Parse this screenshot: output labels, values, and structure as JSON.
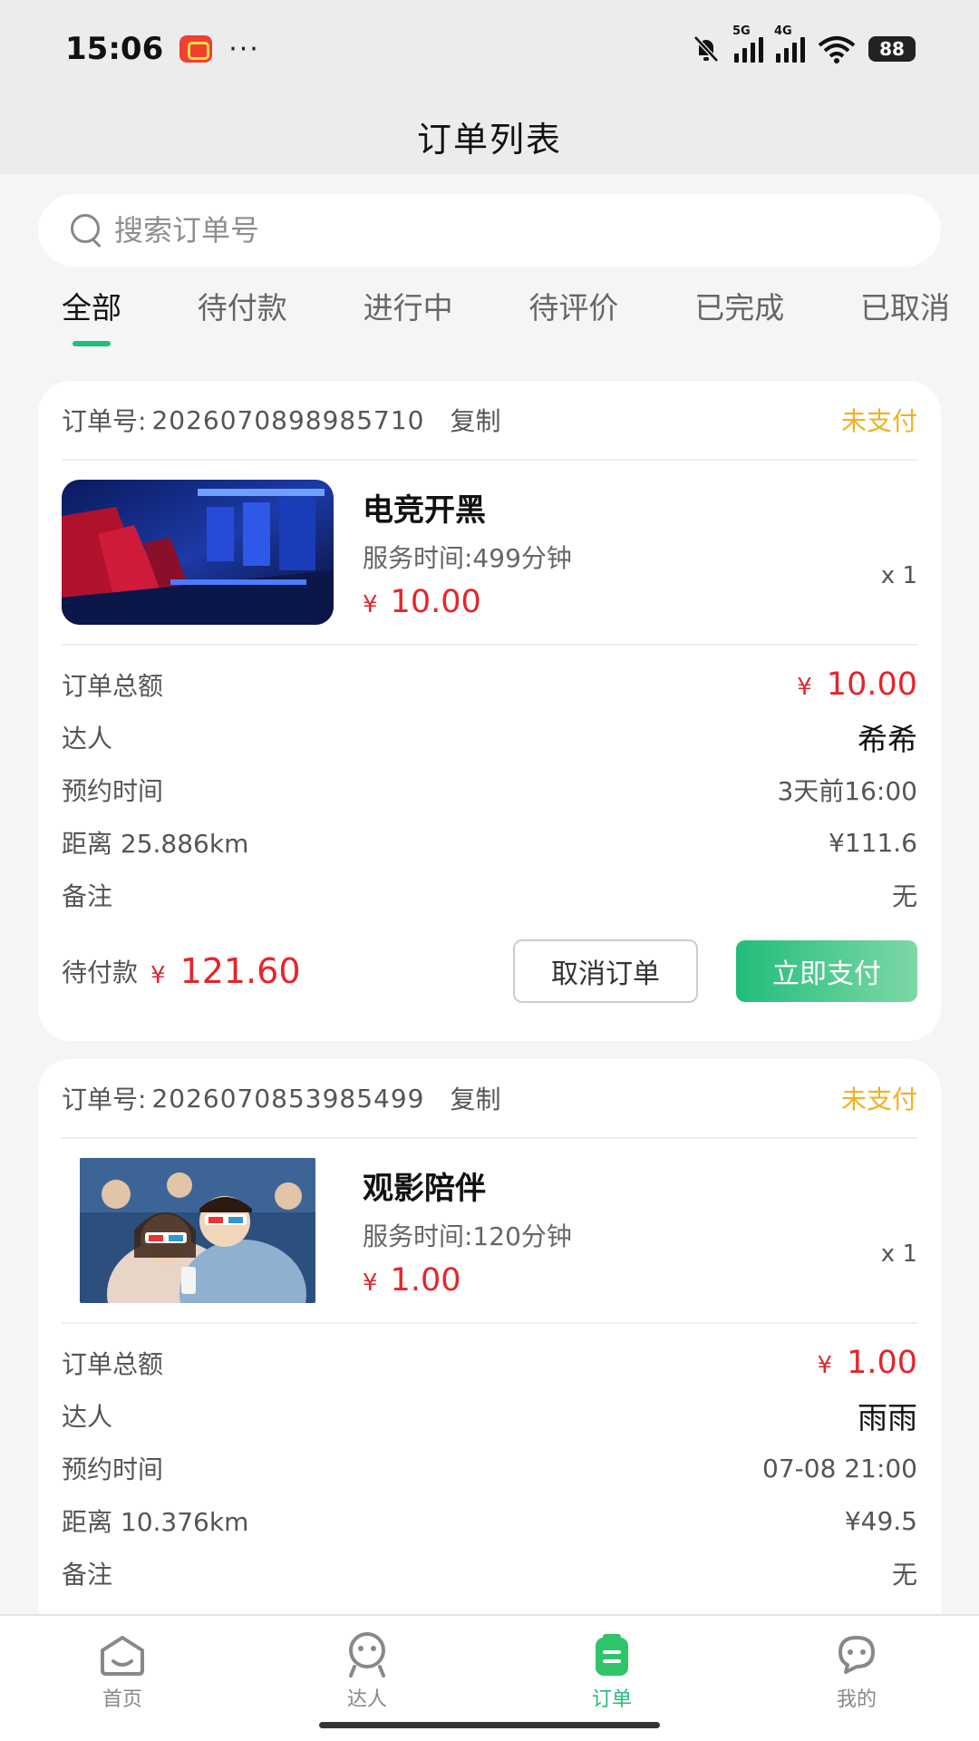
{
  "status_bar": {
    "time": "15:06",
    "dots": "···",
    "net1": "5G",
    "net2": "4G",
    "battery": "88"
  },
  "header": {
    "title": "订单列表"
  },
  "search": {
    "placeholder": "搜索订单号"
  },
  "tabs": [
    {
      "label": "全部",
      "active": true
    },
    {
      "label": "待付款"
    },
    {
      "label": "进行中"
    },
    {
      "label": "待评价"
    },
    {
      "label": "已完成"
    },
    {
      "label": "已取消"
    }
  ],
  "orders": [
    {
      "order_no_label": "订单号:",
      "order_no": "2026070898985710",
      "copy": "复制",
      "status": "未支付",
      "product": {
        "name": "电竞开黑",
        "service_time": "服务时间:499分钟",
        "currency": "¥",
        "price": "10.00",
        "qty": "x 1"
      },
      "total_label": "订单总额",
      "total_currency": "¥",
      "total": "10.00",
      "talent_label": "达人",
      "talent": "希希",
      "booking_label": "预约时间",
      "booking": "3天前16:00",
      "distance": "距离 25.886km",
      "distance_fee": "¥111.6",
      "remark_label": "备注",
      "remark": "无",
      "due_label": "待付款",
      "due_currency": "¥",
      "due": "121.60",
      "cancel_label": "取消订单",
      "pay_label": "立即支付"
    },
    {
      "order_no_label": "订单号:",
      "order_no": "2026070853985499",
      "copy": "复制",
      "status": "未支付",
      "product": {
        "name": "观影陪伴",
        "service_time": "服务时间:120分钟",
        "currency": "¥",
        "price": "1.00",
        "qty": "x 1"
      },
      "total_label": "订单总额",
      "total_currency": "¥",
      "total": "1.00",
      "talent_label": "达人",
      "talent": "雨雨",
      "booking_label": "预约时间",
      "booking": "07-08 21:00",
      "distance": "距离 10.376km",
      "distance_fee": "¥49.5",
      "remark_label": "备注",
      "remark": "无"
    }
  ],
  "bottom_nav": [
    {
      "label": "首页",
      "icon": "home-icon"
    },
    {
      "label": "达人",
      "icon": "talent-icon"
    },
    {
      "label": "订单",
      "icon": "order-icon",
      "active": true
    },
    {
      "label": "我的",
      "icon": "chat-profile-icon"
    }
  ],
  "colors": {
    "accent": "#22bd7a",
    "price_red": "#e6242b",
    "status_yellow": "#f0b020"
  }
}
